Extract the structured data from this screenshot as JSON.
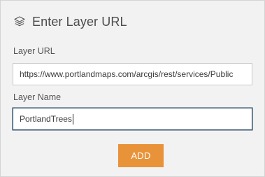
{
  "header": {
    "title": "Enter Layer URL",
    "icon": "layers-icon"
  },
  "form": {
    "url_label": "Layer URL",
    "url_value": "https://www.portlandmaps.com/arcgis/rest/services/Public",
    "name_label": "Layer Name",
    "name_value": "PortlandTrees"
  },
  "actions": {
    "add_label": "ADD"
  },
  "colors": {
    "panel_bg": "#f2f2f2",
    "accent_button": "#e8933a",
    "focus_border": "#2e4d6b"
  }
}
